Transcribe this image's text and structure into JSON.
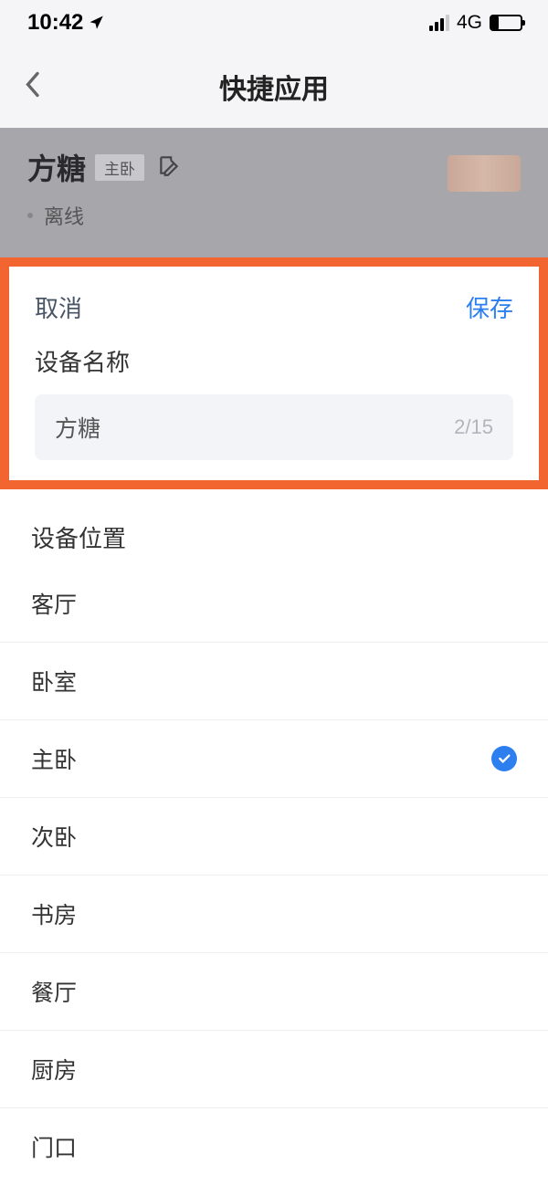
{
  "status_bar": {
    "time": "10:42",
    "network": "4G"
  },
  "nav": {
    "title": "快捷应用"
  },
  "device": {
    "name": "方糖",
    "room_tag": "主卧",
    "status": "离线"
  },
  "modal": {
    "cancel": "取消",
    "save": "保存",
    "name_label": "设备名称",
    "name_value": "方糖",
    "name_counter": "2/15"
  },
  "location": {
    "label": "设备位置",
    "selected": "主卧",
    "items": [
      "客厅",
      "卧室",
      "主卧",
      "次卧",
      "书房",
      "餐厅",
      "厨房",
      "门口"
    ]
  }
}
